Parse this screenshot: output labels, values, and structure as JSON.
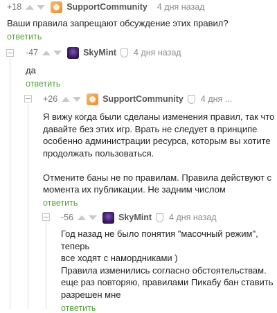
{
  "comments": [
    {
      "rating": "+18",
      "author": "SupportCommunity",
      "time": "4 дня назад",
      "text": "Ваши правила запрещают обсуждение этих правил?",
      "reply": "ответить"
    },
    {
      "rating": "-47",
      "author": "SkyMint",
      "time": "4 дня назад",
      "text": "да",
      "reply": "ответить"
    },
    {
      "rating": "+26",
      "author": "SupportCommunity",
      "time": "4 дня ...",
      "text": "Я вижу когда были сделаны изменения правил, так что\nдавайте без этих игр. Врать не следует в принципе\nособенно администрации ресурса, которым вы хотите\nпродолжать пользоваться.\n\nОтмените баны не по правилам. Правила действуют с\nмомента их публикации. Не задним числом",
      "reply": "ответить"
    },
    {
      "rating": "-56",
      "author": "SkyMint",
      "time": "4 дня назад",
      "text": "Год назад не было понятия \"масочный режим\", теперь\nвсе ходят с намордниками )\nПравила изменились согласно обстоятельствам.\nеще раз повторяю, правилами Пикабу бан ставить\nразрешен мне",
      "reply": "ответить"
    }
  ],
  "icons": {
    "upvote": "arrow-up-icon",
    "downvote": "arrow-down-icon",
    "collapse": "minus-box-icon",
    "moderator": "shield-icon"
  }
}
